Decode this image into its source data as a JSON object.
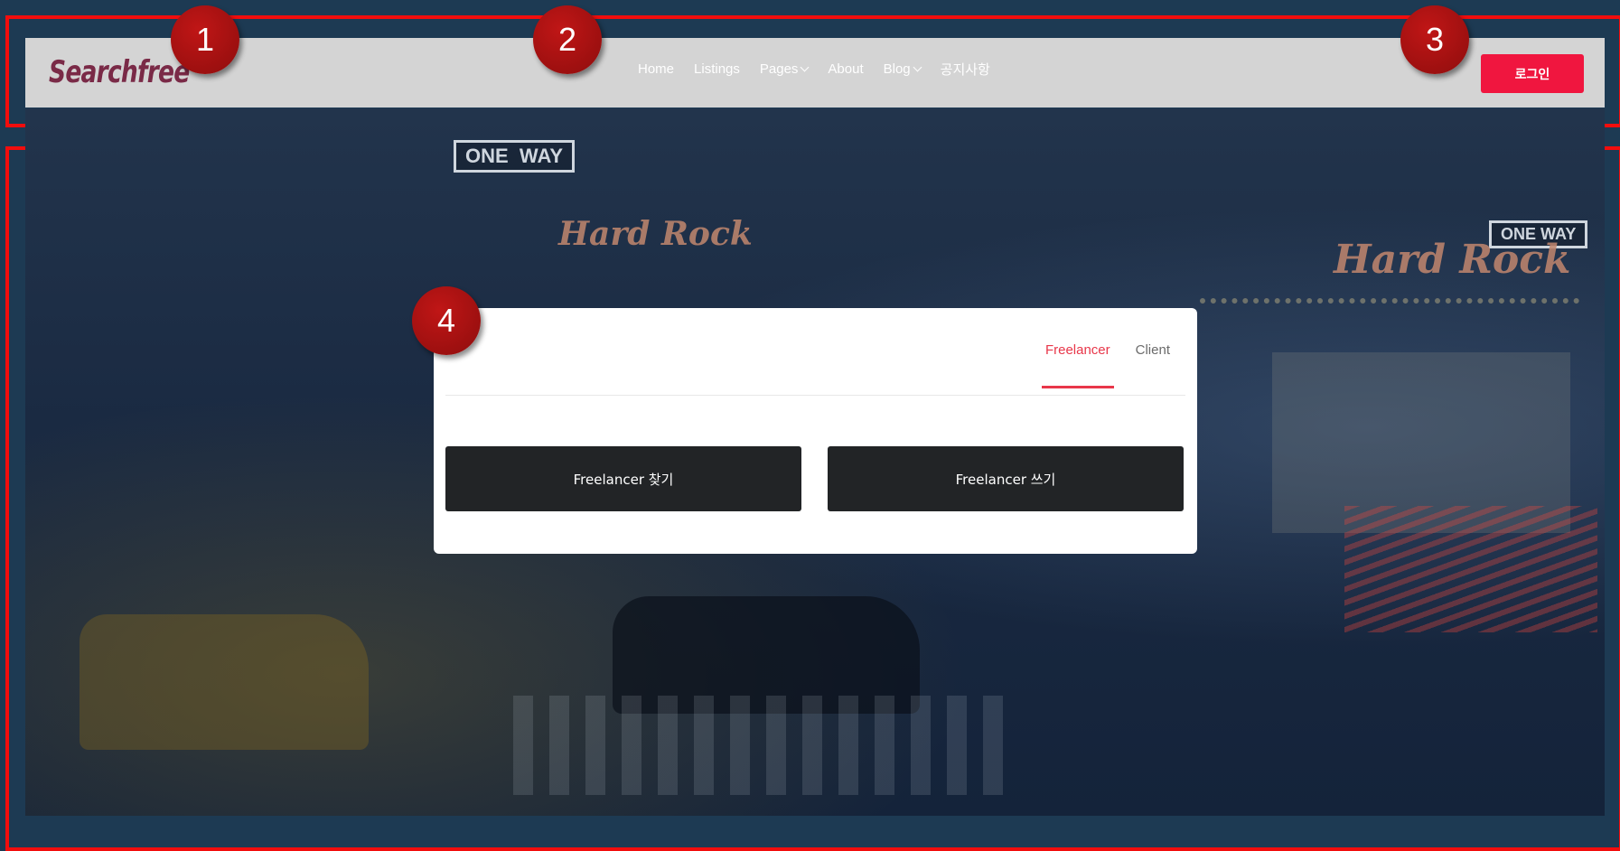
{
  "header": {
    "logo": "Searchfree",
    "nav": [
      {
        "label": "Home",
        "has_dropdown": false
      },
      {
        "label": "Listings",
        "has_dropdown": false
      },
      {
        "label": "Pages",
        "has_dropdown": true
      },
      {
        "label": "About",
        "has_dropdown": false
      },
      {
        "label": "Blog",
        "has_dropdown": true
      },
      {
        "label": "공지사항",
        "has_dropdown": false
      }
    ],
    "login_label": "로그인"
  },
  "search_card": {
    "tabs": [
      "Freelancer",
      "Client"
    ],
    "active_tab": "Freelancer",
    "buttons": [
      "Freelancer 찾기",
      "Freelancer 쓰기"
    ]
  },
  "annotations": {
    "badges": [
      "1",
      "2",
      "3",
      "4"
    ]
  },
  "colors": {
    "accent": "#f0163f",
    "annotation": "#f20d0d",
    "page_bg": "#1d3a53",
    "header_bg": "#d4d4d4",
    "button_dark": "#222426"
  }
}
